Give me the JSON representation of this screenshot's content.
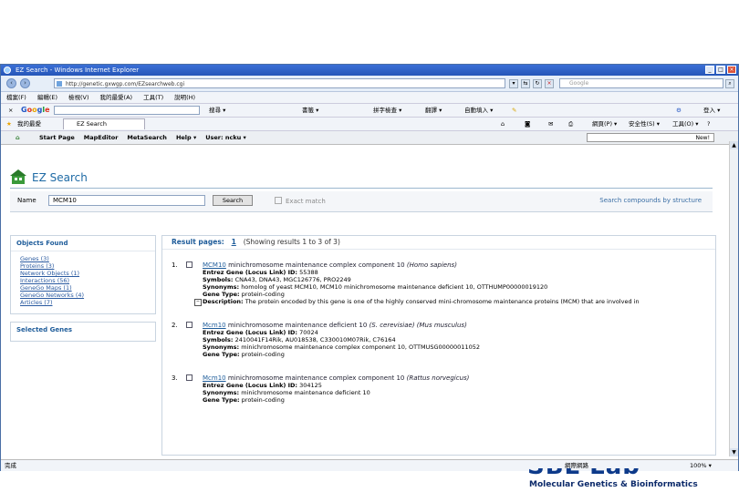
{
  "window": {
    "title": "EZ Search - Windows Internet Explorer",
    "controls": [
      "_",
      "□",
      "×"
    ]
  },
  "address_bar": {
    "url": "http://genetic.gxwgp.com/EZsearchweb.cgi",
    "search_placeholder": "Google"
  },
  "menu": {
    "items": [
      "檔案(F)",
      "編輯(E)",
      "檢視(V)",
      "我的最愛(A)",
      "工具(T)",
      "說明(H)"
    ]
  },
  "google_toolbar": {
    "close": "×",
    "logo": [
      "G",
      "o",
      "o",
      "g",
      "l",
      "e"
    ],
    "items": [
      "搜尋 ▾",
      "書籤 ▾",
      "拼字檢查 ▾",
      "翻譯 ▾",
      "自動填入 ▾"
    ],
    "right": "登入 ▾"
  },
  "tabs_bar": {
    "favorites": "我的最愛",
    "tab_title": "EZ Search",
    "right_tools": [
      "網頁(P) ▾",
      "安全性(S) ▾",
      "工具(O) ▾"
    ]
  },
  "app_toolbar": {
    "items": [
      "Start Page",
      "MapEditor",
      "MetaSearch",
      "Help ▾",
      "User: ncku ▾"
    ],
    "right_button": "New!"
  },
  "brand": {
    "title": "EZ Search"
  },
  "search": {
    "label": "Name",
    "value": "MCM10",
    "button": "Search",
    "exact": "Exact match",
    "structure_link": "Search compounds by structure"
  },
  "objects_found": {
    "title": "Objects Found",
    "items": [
      "Genes (3)",
      "Proteins (3)",
      "Network Objects (1)",
      "Interactions (56)",
      "GeneGo Maps (1)",
      "GeneGo Networks (4)",
      "Articles (7)"
    ]
  },
  "selected_genes": {
    "title": "Selected Genes"
  },
  "results": {
    "label": "Result pages:",
    "page": "1",
    "showing": "(Showing results 1 to 3 of 3)",
    "items": [
      {
        "num": "1.",
        "symbol": "MCM10",
        "title": "minichromosome maintenance complex component 10",
        "species": "(Homo sapiens)",
        "lines": [
          {
            "k": "Entrez Gene (Locus Link) ID:",
            "v": " 55388"
          },
          {
            "k": "Symbols:",
            "v": " CNA43, DNA43, MGC126776, PRO2249"
          },
          {
            "k": "Synonyms:",
            "v": " homolog of yeast MCM10, MCM10 minichromosome maintenance deficient 10, OTTHUMP00000019120"
          },
          {
            "k": "Gene Type:",
            "v": " protein-coding"
          },
          {
            "k": "Description:",
            "v": " The protein encoded by this gene is one of the highly conserved mini-chromosome maintenance proteins (MCM) that are involved in"
          }
        ]
      },
      {
        "num": "2.",
        "symbol": "Mcm10",
        "title": "minichromosome maintenance deficient 10",
        "species": "(S. cerevisiae) (Mus musculus)",
        "lines": [
          {
            "k": "Entrez Gene (Locus Link) ID:",
            "v": " 70024"
          },
          {
            "k": "Symbols:",
            "v": " 2410041F14Rik, AU018538, C330010M07Rik, C76164"
          },
          {
            "k": "Synonyms:",
            "v": " minichromosome maintenance complex component 10, OTTMUSG00000011052"
          },
          {
            "k": "Gene Type:",
            "v": " protein-coding"
          }
        ]
      },
      {
        "num": "3.",
        "symbol": "Mcm10",
        "title": "minichromosome maintenance complex component 10",
        "species": "(Rattus norvegicus)",
        "lines": [
          {
            "k": "Entrez Gene (Locus Link) ID:",
            "v": " 304125"
          },
          {
            "k": "Synonyms:",
            "v": " minichromosome maintenance deficient 10"
          },
          {
            "k": "Gene Type:",
            "v": " protein-coding"
          }
        ]
      }
    ]
  },
  "status_bar": {
    "left": "完成",
    "right": "網際網路",
    "zoom": "100% ▾"
  },
  "footer": {
    "mark": "SBL Lab",
    "caption": "Molecular Genetics & Bioinformatics"
  },
  "colors": {
    "accent": "#1e5c9a",
    "titlebar": "#2556b8"
  }
}
